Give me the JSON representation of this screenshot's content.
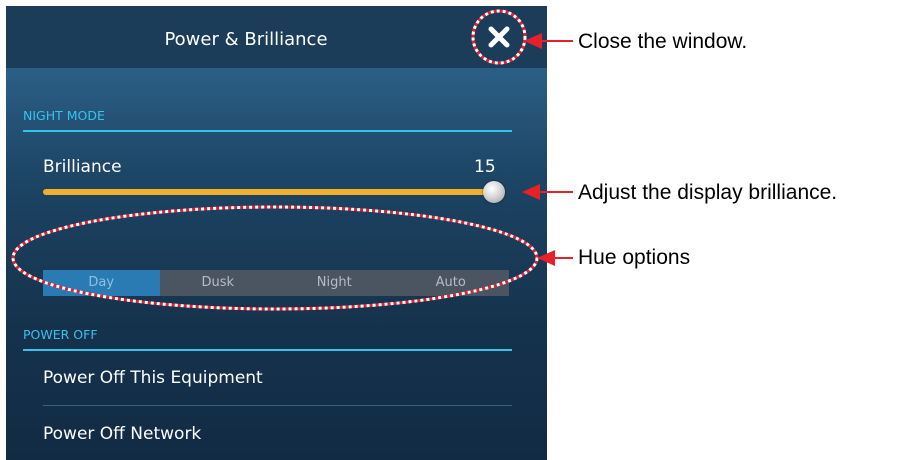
{
  "window": {
    "title": "Power & Brilliance",
    "close_icon": "close-icon"
  },
  "night_mode": {
    "header": "NIGHT MODE",
    "brilliance_label": "Brilliance",
    "brilliance_value": "15",
    "slider_fraction": 1.0,
    "hue_options": [
      "Day",
      "Dusk",
      "Night",
      "Auto"
    ],
    "hue_selected": "Day"
  },
  "power_off": {
    "header": "POWER OFF",
    "items": [
      "Power Off This Equipment",
      "Power Off Network"
    ]
  },
  "annotations": {
    "close": "Close the window.",
    "brilliance": "Adjust the display brilliance.",
    "hue": "Hue options"
  },
  "colors": {
    "panel_title_bg": "#1b3d5a",
    "accent_cyan": "#35c3ee",
    "slider": "#f0b02b",
    "segment_active": "#2a7bb3",
    "callout_red": "#e8202a"
  }
}
